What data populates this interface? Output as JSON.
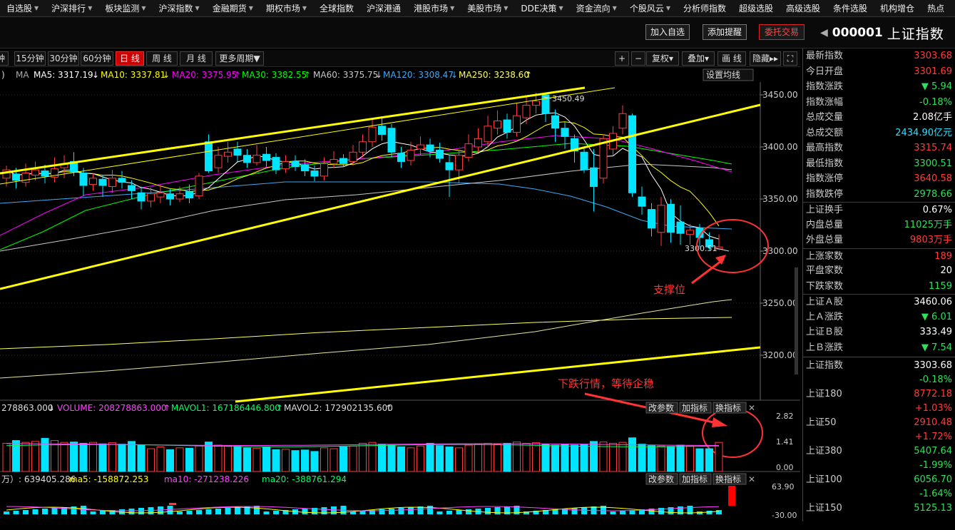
{
  "topnav": [
    "自选股",
    "沪深排行",
    "板块监测",
    "沪深指数",
    "金融期货",
    "期权市场",
    "全球指数",
    "沪深港通",
    "港股市场",
    "美股市场",
    "DDE决策",
    "资金流向",
    "个股风云",
    "分析师指数",
    "超级选股",
    "高级选股",
    "条件选股",
    "机构增仓",
    "热点"
  ],
  "topnav_caret": [
    true,
    true,
    true,
    true,
    true,
    true,
    false,
    false,
    true,
    true,
    true,
    true,
    true,
    false,
    false,
    false,
    false,
    false,
    false
  ],
  "buttons": {
    "add_watch": "加入自选",
    "add_alert": "添加提醒",
    "trade": "委托交易"
  },
  "stock": {
    "code": "000001",
    "name": "上证指数"
  },
  "periods": [
    "钟",
    "15分钟",
    "30分钟",
    "60分钟",
    "日 线",
    "周 线",
    "月 线",
    "更多周期▼"
  ],
  "period_active": 4,
  "chart_tools": [
    "+",
    "−",
    "复权▾",
    "叠加▾",
    "画 线",
    "隐藏▸▸"
  ],
  "ma": {
    "prefix": ")",
    "label": "MA",
    "ma5": "MA5: 3317.19",
    "ma10": "MA10: 3337.81",
    "ma20": "MA20: 3375.95",
    "ma30": "MA30: 3382.55",
    "ma60": "MA60: 3375.75",
    "ma120": "MA120: 3308.47",
    "ma250": "MA250: 3238.60",
    "setting": "设置均线"
  },
  "yaxis": [
    "3450.00",
    "3400.00",
    "3350.00",
    "3300.00",
    "3250.00",
    "3200.00"
  ],
  "labels": {
    "high": "3450.49",
    "low": "3300.51"
  },
  "annotations": {
    "support": "支撑位",
    "downtrend": "下跌行情，等待企稳"
  },
  "volume": {
    "prefix": "278863.000",
    "label": "VOLUME: 208278863.000",
    "mavol1": "MAVOL1: 167186446.800",
    "mavol2": "MAVOL2: 172902135.600",
    "btn_param": "改参数",
    "btn_add": "加指标",
    "btn_switch": "换指标",
    "axis": [
      "2.82",
      "1.41",
      "0.00"
    ]
  },
  "money": {
    "prefix": "万）: 639405.286",
    "ma5": "ma5: -158872.253",
    "ma10": "ma10: -271238.226",
    "ma20": "ma20: -388761.294",
    "btn_param": "改参数",
    "btn_add": "加指标",
    "btn_switch": "换指标",
    "axis": [
      "63.90",
      "-30.00"
    ]
  },
  "quote": [
    {
      "label": "最新指数",
      "value": "3303.68",
      "color": "red"
    },
    {
      "label": "今日开盘",
      "value": "3301.69",
      "color": "red"
    },
    {
      "label": "指数涨跌",
      "value": "▼ 5.94",
      "color": "green"
    },
    {
      "label": "指数涨幅",
      "value": "-0.18%",
      "color": "green"
    },
    {
      "label": "总成交量",
      "value": "2.08亿手",
      "color": "white"
    },
    {
      "label": "总成交额",
      "value": "2434.90亿元",
      "color": "cyan"
    },
    {
      "label": "最高指数",
      "value": "3315.74",
      "color": "red"
    },
    {
      "label": "最低指数",
      "value": "3300.51",
      "color": "green"
    },
    {
      "label": "指数涨停",
      "value": "3640.58",
      "color": "red"
    },
    {
      "label": "指数跌停",
      "value": "2978.66",
      "color": "green"
    },
    {
      "label": "上证换手",
      "value": "0.67%",
      "color": "white",
      "sep": true
    },
    {
      "label": "内盘总量",
      "value": "11025万手",
      "color": "green"
    },
    {
      "label": "外盘总量",
      "value": "9803万手",
      "color": "red"
    },
    {
      "label": "上涨家数",
      "value": "189",
      "color": "red",
      "sep": true
    },
    {
      "label": "平盘家数",
      "value": "20",
      "color": "white"
    },
    {
      "label": "下跌家数",
      "value": "1159",
      "color": "green"
    },
    {
      "label": "上证Ａ股",
      "value": "3460.06",
      "color": "white",
      "sep": true
    },
    {
      "label": "上Ａ涨跌",
      "value": "▼ 6.01",
      "color": "green"
    },
    {
      "label": "上证Ｂ股",
      "value": "333.49",
      "color": "white"
    },
    {
      "label": "上Ｂ涨跌",
      "value": "▼ 7.54",
      "color": "green"
    }
  ],
  "indices": [
    {
      "name": "上证指数",
      "value": "3303.68",
      "vc": "white",
      "pct": "-0.18%",
      "pc": "green"
    },
    {
      "name": "上证180",
      "value": "8772.18",
      "vc": "red",
      "pct": "+1.03%",
      "pc": "red"
    },
    {
      "name": "上证50",
      "value": "2910.48",
      "vc": "red",
      "pct": "+1.72%",
      "pc": "red"
    },
    {
      "name": "上证380",
      "value": "5407.64",
      "vc": "green",
      "pct": "-1.99%",
      "pc": "green"
    },
    {
      "name": "上证100",
      "value": "6056.70",
      "vc": "green",
      "pct": "-1.64%",
      "pc": "green"
    },
    {
      "name": "上证150",
      "value": "5125.13",
      "vc": "green",
      "pct": "",
      "pc": "green"
    }
  ],
  "colors": {
    "up": "#ff3b3b",
    "down": "#00e5ff",
    "ma5": "#ffffff",
    "ma10": "#ffff00",
    "ma20": "#ff00ff",
    "ma30": "#00ff00",
    "ma60": "#c8c8c8",
    "ma120": "#3fa9f5",
    "ma250": "#ffff66",
    "trend": "#ffff00",
    "annotation": "#ff3333"
  }
}
